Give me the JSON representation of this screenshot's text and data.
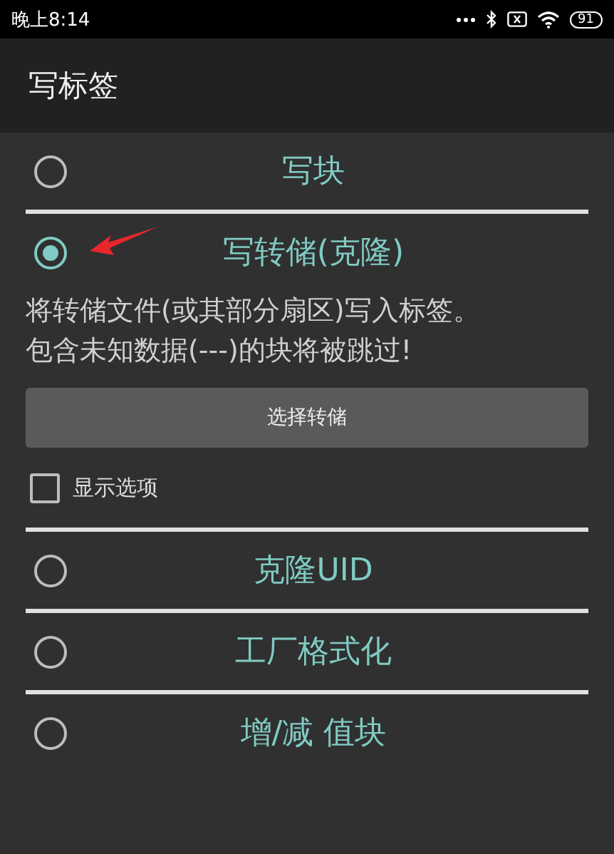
{
  "status_bar": {
    "time": "晚上8:14",
    "battery": "91"
  },
  "toolbar": {
    "title": "写标签"
  },
  "options": [
    {
      "label": "写块",
      "selected": false
    },
    {
      "label": "写转储(克隆)",
      "selected": true,
      "description": [
        "将转储文件(或其部分扇区)写入标签。",
        "包含未知数据(---)的块将被跳过!"
      ],
      "button": "选择转储",
      "checkbox": {
        "label": "显示选项",
        "checked": false
      }
    },
    {
      "label": "克隆UID",
      "selected": false
    },
    {
      "label": "工厂格式化",
      "selected": false
    },
    {
      "label": "增/减 值块",
      "selected": false
    }
  ]
}
